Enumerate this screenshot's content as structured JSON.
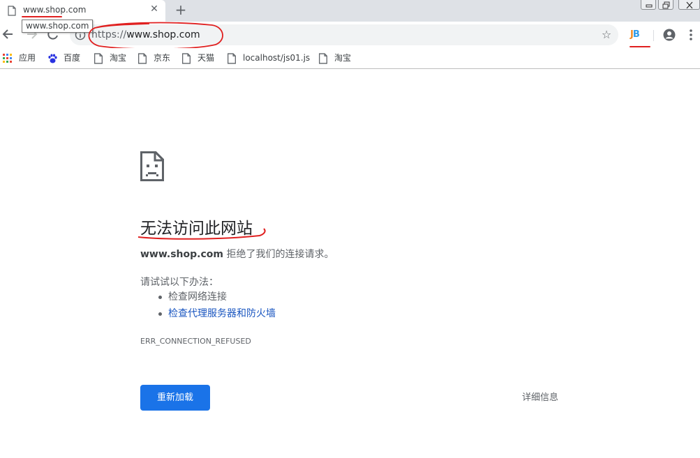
{
  "browser": {
    "tab": {
      "title": "www.shop.com",
      "tooltip": "www.shop.com",
      "favicon": "page-icon",
      "close_glyph": "✕"
    },
    "new_tab_glyph": "+",
    "address": {
      "scheme": "https://",
      "host": "www.shop.com"
    },
    "extension_icon": {
      "letter1": "J",
      "letter2": "B"
    },
    "bookmarks": [
      {
        "label": "应用",
        "icon": "apps-grid-icon"
      },
      {
        "label": "百度",
        "icon": "baidu-paw-icon"
      },
      {
        "label": "淘宝",
        "icon": "page-icon"
      },
      {
        "label": "京东",
        "icon": "page-icon"
      },
      {
        "label": "天猫",
        "icon": "page-icon"
      },
      {
        "label": "localhost/js01.js",
        "icon": "page-icon"
      },
      {
        "label": "淘宝",
        "icon": "page-icon"
      }
    ]
  },
  "error_page": {
    "icon": "sad-page-icon",
    "heading": "无法访问此网站",
    "description": {
      "host": "www.shop.com",
      "message": " 拒绝了我们的连接请求。"
    },
    "suggestions_title": "请试试以下办法：",
    "suggestions": [
      {
        "label": "检查网络连接",
        "is_link": false
      },
      {
        "label": "检查代理服务器和防火墙",
        "is_link": true
      }
    ],
    "error_code": "ERR_CONNECTION_REFUSED",
    "reload_label": "重新加载",
    "details_label": "详细信息"
  },
  "colors": {
    "primary_button": "#1a73e8",
    "link": "#1a56c0",
    "annotation": "#e02020"
  }
}
